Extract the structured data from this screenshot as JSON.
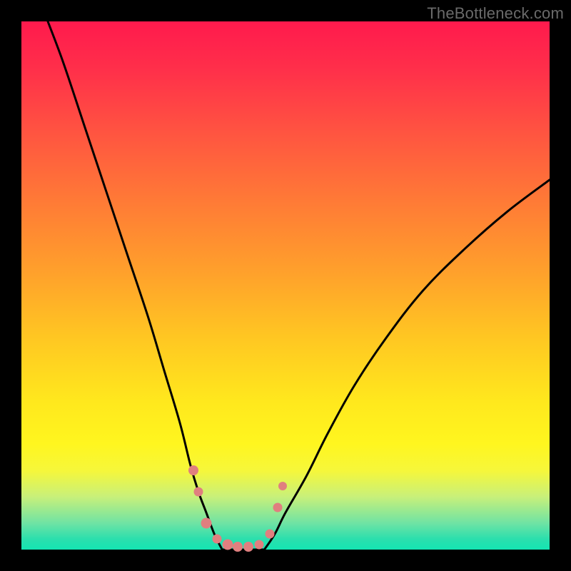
{
  "watermark": "TheBottleneck.com",
  "colors": {
    "frame": "#000000",
    "curve": "#000000",
    "marker_fill": "#e07f7f",
    "gradient_top": "#ff1a4d",
    "gradient_bottom": "#14e5b2"
  },
  "chart_data": {
    "type": "line",
    "title": "",
    "xlabel": "",
    "ylabel": "",
    "xlim": [
      0,
      100
    ],
    "ylim": [
      0,
      100
    ],
    "grid": false,
    "legend": false,
    "series": [
      {
        "name": "left-branch",
        "x": [
          5,
          8,
          12,
          16,
          20,
          24,
          27,
          30,
          32,
          33.5,
          35,
          36.5,
          38
        ],
        "y": [
          100,
          92,
          80,
          68,
          56,
          44,
          34,
          24,
          16,
          11,
          7,
          3,
          0
        ]
      },
      {
        "name": "valley-floor",
        "x": [
          38,
          40,
          42,
          44,
          46
        ],
        "y": [
          0,
          0,
          0,
          0,
          0
        ]
      },
      {
        "name": "right-branch",
        "x": [
          46,
          48,
          50,
          54,
          58,
          63,
          69,
          76,
          84,
          92,
          100
        ],
        "y": [
          0,
          3,
          7,
          14,
          22,
          31,
          40,
          49,
          57,
          64,
          70
        ]
      }
    ],
    "markers": [
      {
        "x": 32.5,
        "y": 15,
        "size": 14
      },
      {
        "x": 33.5,
        "y": 11,
        "size": 13
      },
      {
        "x": 35.0,
        "y": 5,
        "size": 15
      },
      {
        "x": 37.0,
        "y": 2,
        "size": 13
      },
      {
        "x": 39.0,
        "y": 1,
        "size": 15
      },
      {
        "x": 41.0,
        "y": 0.5,
        "size": 14
      },
      {
        "x": 43.0,
        "y": 0.5,
        "size": 14
      },
      {
        "x": 45.0,
        "y": 1,
        "size": 13
      },
      {
        "x": 47.0,
        "y": 3,
        "size": 13
      },
      {
        "x": 48.5,
        "y": 8,
        "size": 13
      },
      {
        "x": 49.5,
        "y": 12,
        "size": 12
      }
    ],
    "annotations": []
  }
}
